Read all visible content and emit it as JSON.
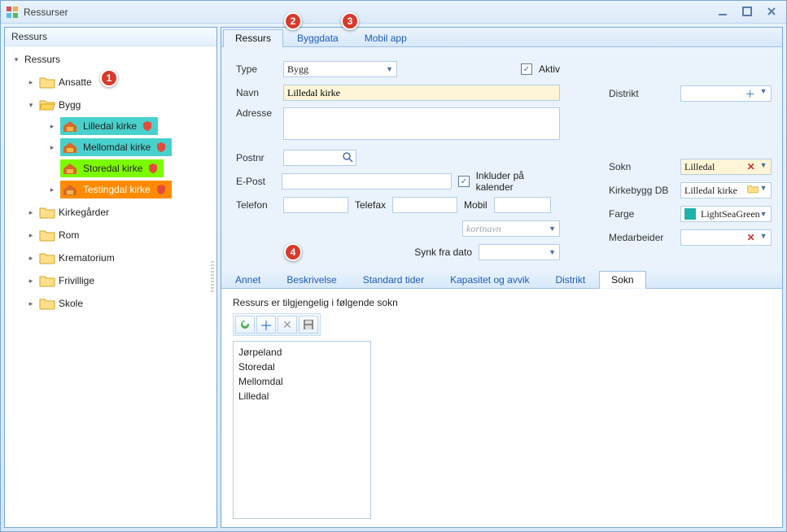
{
  "window": {
    "title": "Ressurser"
  },
  "tree": {
    "header": "Ressurs",
    "root": "Ressurs",
    "nodes": {
      "ansatte": "Ansatte",
      "bygg": "Bygg",
      "kirkegarder": "Kirkegårder",
      "rom": "Rom",
      "krematorium": "Krematorium",
      "frivillige": "Frivillige",
      "skole": "Skole"
    },
    "bygg_children": [
      {
        "label": "Lilledal kirke",
        "hl": "hl-teal"
      },
      {
        "label": "Mellomdal kirke",
        "hl": "hl-teal"
      },
      {
        "label": "Storedal kirke",
        "hl": "hl-green"
      },
      {
        "label": "Testingdal kirke",
        "hl": "hl-orange"
      }
    ]
  },
  "main_tabs": {
    "ressurs": "Ressurs",
    "byggdata": "Byggdata",
    "mobilapp": "Mobil app"
  },
  "form": {
    "labels": {
      "type": "Type",
      "navn": "Navn",
      "adresse": "Adresse",
      "postnr": "Postnr",
      "epost": "E-Post",
      "telefon": "Telefon",
      "telefax": "Telefax",
      "mobil": "Mobil",
      "kortnavn_hint": "kortnavn",
      "synk": "Synk fra dato",
      "inkluder": "Inkluder på kalender",
      "aktiv": "Aktiv",
      "distrikt": "Distrikt",
      "sokn": "Sokn",
      "kirkebygg": "Kirkebygg DB",
      "farge": "Farge",
      "medarbeider": "Medarbeider"
    },
    "values": {
      "type": "Bygg",
      "navn": "Lilledal kirke",
      "sokn": "Lilledal",
      "kirkebygg": "Lilledal kirke",
      "farge_name": "LightSeaGreen",
      "farge_hex": "#20b2aa"
    }
  },
  "sub_tabs": {
    "annet": "Annet",
    "beskrivelse": "Beskrivelse",
    "standard": "Standard tider",
    "kapasitet": "Kapasitet og avvik",
    "distrikt": "Distrikt",
    "sokn": "Sokn"
  },
  "sokn_panel": {
    "caption": "Ressurs er tilgjengelig i følgende sokn",
    "items": [
      "Jørpeland",
      "Storedal",
      "Mellomdal",
      "Lilledal"
    ]
  },
  "annotations": [
    "1",
    "2",
    "3",
    "4"
  ]
}
